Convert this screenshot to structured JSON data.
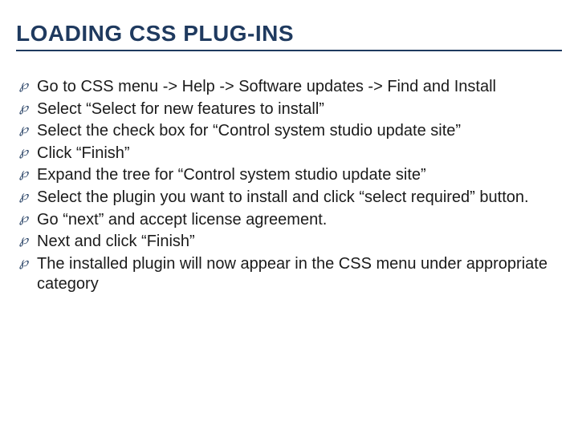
{
  "title": "LOADING CSS PLUG-INS",
  "bullet_glyph": "❥",
  "items": [
    "Go to CSS menu -> Help -> Software updates -> Find and Install",
    "Select  “Select for new features to install”",
    "Select the check box for “Control system studio update site”",
    "Click “Finish”",
    "Expand the tree for “Control system studio update site”",
    "Select the plugin you want to install and click “select required” button.",
    "Go “next” and accept license agreement.",
    "Next and click “Finish”",
    "The installed plugin will now appear in the CSS menu under appropriate category"
  ]
}
